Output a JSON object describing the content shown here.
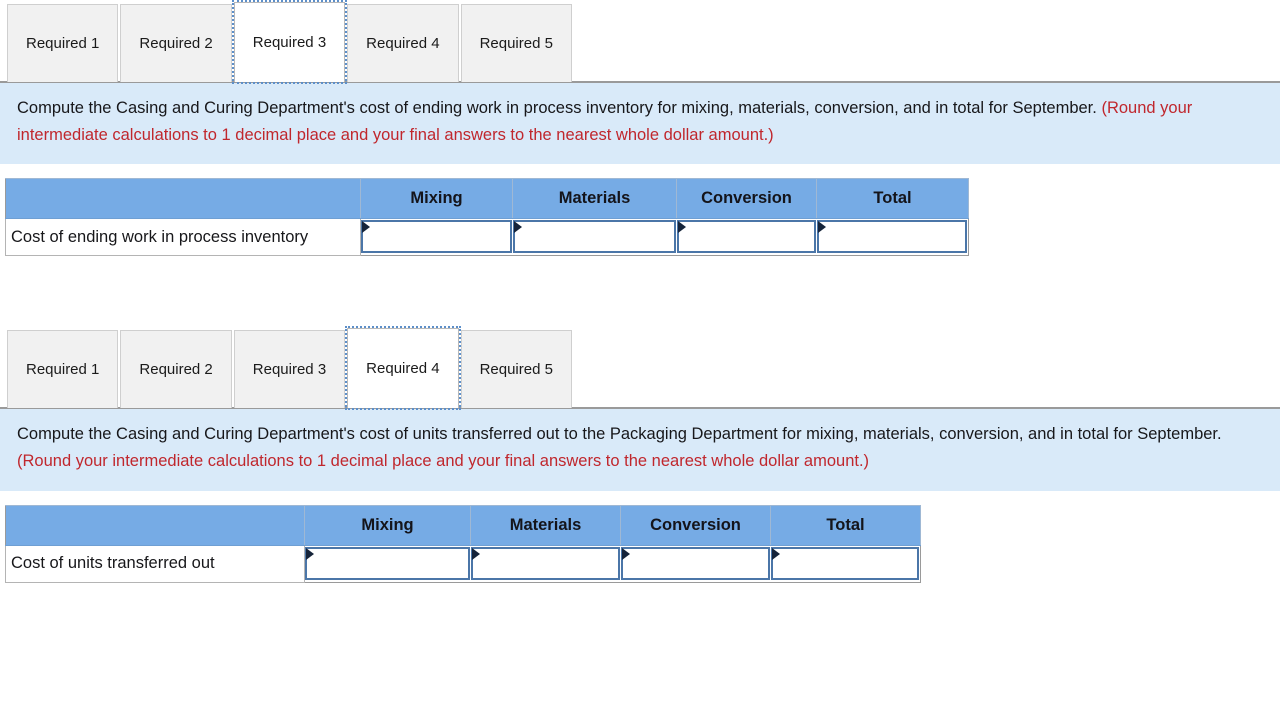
{
  "sections": [
    {
      "id": "required-3",
      "tabs": [
        {
          "label": "Required 1",
          "active": false
        },
        {
          "label": "Required 2",
          "active": false
        },
        {
          "label": "Required 3",
          "active": true
        },
        {
          "label": "Required 4",
          "active": false
        },
        {
          "label": "Required 5",
          "active": false
        }
      ],
      "instruction": {
        "main": "Compute the Casing and Curing Department's cost of ending work in process inventory for mixing, materials, conversion, and in total for September.",
        "hint": "(Round your intermediate calculations to 1 decimal place and your final answers to the nearest whole dollar amount.)"
      },
      "table": {
        "corner_header": "",
        "columns": [
          "Mixing",
          "Materials",
          "Conversion",
          "Total"
        ],
        "rows": [
          {
            "label": "Cost of ending work in process inventory",
            "values": [
              "",
              "",
              "",
              ""
            ]
          }
        ]
      }
    },
    {
      "id": "required-4",
      "tabs": [
        {
          "label": "Required 1",
          "active": false
        },
        {
          "label": "Required 2",
          "active": false
        },
        {
          "label": "Required 3",
          "active": false
        },
        {
          "label": "Required 4",
          "active": true
        },
        {
          "label": "Required 5",
          "active": false
        }
      ],
      "instruction": {
        "main": "Compute the Casing and Curing Department's cost of units transferred out to the Packaging Department for mixing, materials, conversion, and in total for September.",
        "hint": "(Round your intermediate calculations to 1 decimal place and your final answers to the nearest whole dollar amount.)"
      },
      "table": {
        "corner_header": "",
        "columns": [
          "Mixing",
          "Materials",
          "Conversion",
          "Total"
        ],
        "rows": [
          {
            "label": "Cost of units transferred out",
            "values": [
              "",
              "",
              "",
              ""
            ]
          }
        ]
      }
    }
  ],
  "colors": {
    "header_blue": "#76abe5",
    "panel_blue": "#d9eaf9",
    "hint_red": "#c0272d",
    "input_border": "#4b76a8",
    "tab_inactive": "#f1f1f1",
    "tab_active": "#ffffff",
    "focus_outline": "#5d8fc9"
  }
}
